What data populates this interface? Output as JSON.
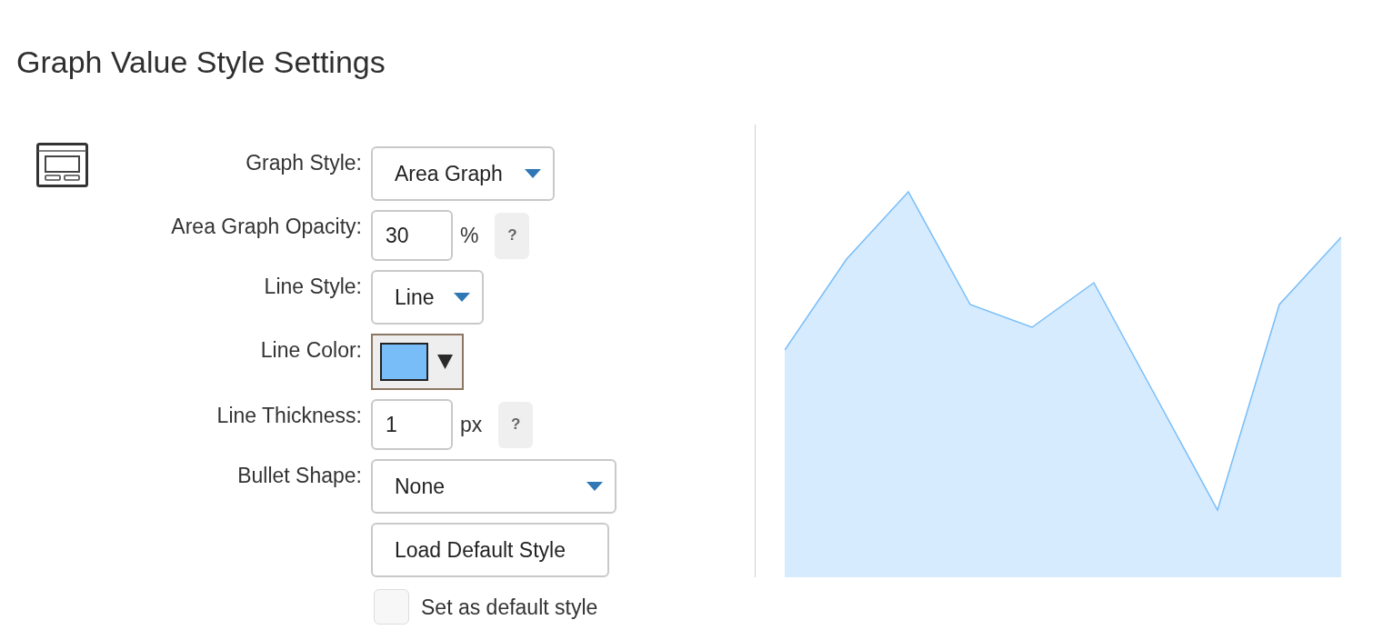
{
  "title": "Graph Value Style Settings",
  "settings": [
    {
      "kind": "select",
      "label": "Graph Style:",
      "value": "Area Graph"
    },
    {
      "kind": "number",
      "label": "Area Graph Opacity:",
      "value": "30",
      "unit": "%",
      "help": "?"
    },
    {
      "kind": "select",
      "label": "Line Style:",
      "value": "Line"
    },
    {
      "kind": "color",
      "label": "Line Color:",
      "color": "#78bdf8"
    },
    {
      "kind": "number",
      "label": "Line Thickness:",
      "value": "1",
      "unit": "px",
      "help": "?"
    },
    {
      "kind": "select",
      "label": "Bullet Shape:",
      "value": "None"
    }
  ],
  "load_button": "Load Default Style",
  "default_checkbox": {
    "label": "Set as default style",
    "checked": false
  }
}
